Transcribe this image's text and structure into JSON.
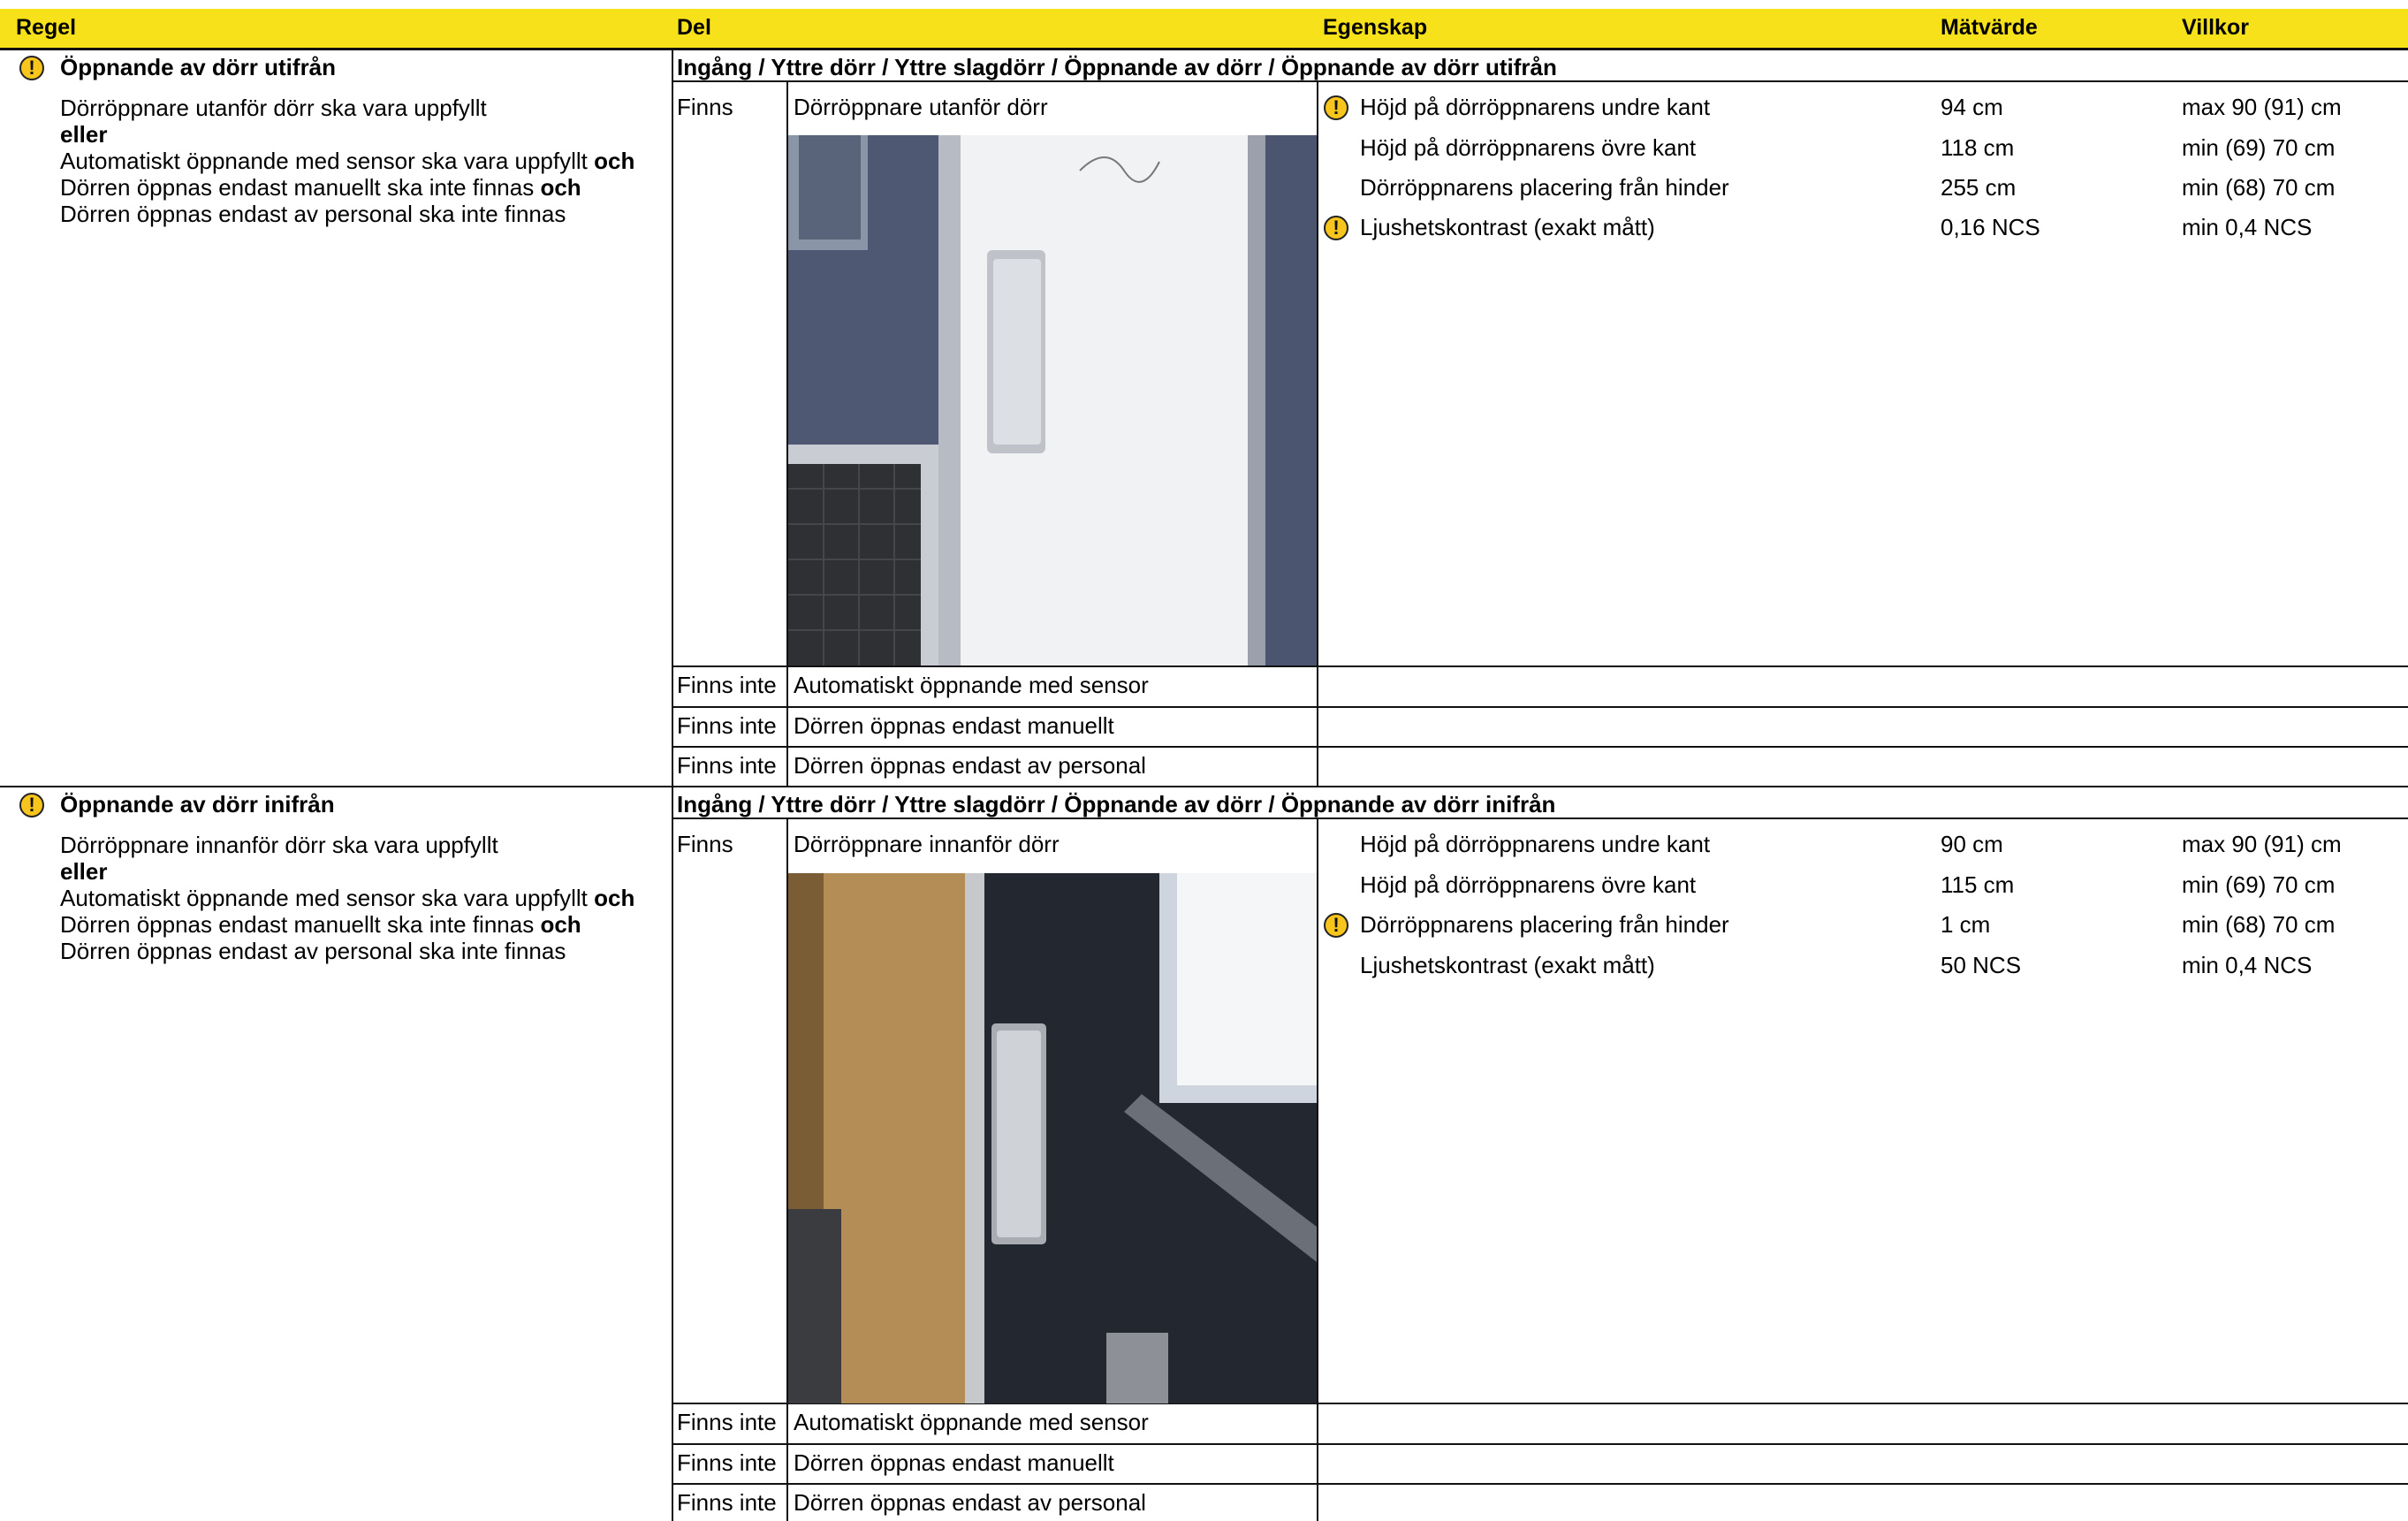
{
  "header": {
    "regel": "Regel",
    "del": "Del",
    "egenskap": "Egenskap",
    "matvarde": "Mätvärde",
    "villkor": "Villkor"
  },
  "sections": [
    {
      "title": "Öppnande av dörr utifrån",
      "rule_lines": [
        "Dörröppnare utanför dörr ska vara uppfyllt",
        "eller",
        "Automatiskt öppnande med sensor ska vara uppfyllt",
        "Dörren öppnas endast manuellt ska inte finnas",
        "Dörren öppnas endast av personal ska inte finnas"
      ],
      "och": "och",
      "path": "Ingång / Yttre dörr / Yttre slagdörr  / Öppnande av dörr / Öppnande av dörr utifrån",
      "parts": [
        {
          "status": "Finns",
          "name": "Dörröppnare utanför dörr"
        },
        {
          "status": "Finns inte",
          "name": "Automatiskt öppnande med sensor"
        },
        {
          "status": "Finns inte",
          "name": "Dörren öppnas endast manuellt"
        },
        {
          "status": "Finns inte",
          "name": "Dörren öppnas endast av personal"
        }
      ],
      "measurements": [
        {
          "property": "Höjd på dörröppnarens undre kant",
          "value": "94 cm",
          "condition": "max 90 (91) cm",
          "warning": true
        },
        {
          "property": "Höjd på dörröppnarens övre kant",
          "value": "118 cm",
          "condition": "min (69) 70 cm",
          "warning": false
        },
        {
          "property": "Dörröppnarens placering från hinder",
          "value": "255 cm",
          "condition": "min (68) 70 cm",
          "warning": false
        },
        {
          "property": "Ljushetskontrast (exakt mått)",
          "value": "0,16 NCS",
          "condition": "min 0,4 NCS",
          "warning": true
        }
      ]
    },
    {
      "title": "Öppnande av dörr inifrån",
      "rule_lines": [
        "Dörröppnare innanför dörr ska vara uppfyllt",
        "eller",
        "Automatiskt öppnande med sensor ska vara uppfyllt",
        "Dörren öppnas endast manuellt ska inte finnas",
        "Dörren öppnas endast av personal ska inte finnas"
      ],
      "och": "och",
      "path": "Ingång / Yttre dörr / Yttre slagdörr  / Öppnande av dörr / Öppnande av dörr inifrån",
      "parts": [
        {
          "status": "Finns",
          "name": "Dörröppnare innanför dörr"
        },
        {
          "status": "Finns inte",
          "name": "Automatiskt öppnande med sensor"
        },
        {
          "status": "Finns inte",
          "name": "Dörren öppnas endast manuellt"
        },
        {
          "status": "Finns inte",
          "name": "Dörren öppnas endast av personal"
        }
      ],
      "measurements": [
        {
          "property": "Höjd på dörröppnarens undre kant",
          "value": "90 cm",
          "condition": "max 90 (91) cm",
          "warning": false
        },
        {
          "property": "Höjd på dörröppnarens övre kant",
          "value": "115 cm",
          "condition": "min (69) 70 cm",
          "warning": false
        },
        {
          "property": "Dörröppnarens placering från hinder",
          "value": "1 cm",
          "condition": "min (68) 70 cm",
          "warning": true
        },
        {
          "property": "Ljushetskontrast (exakt mått)",
          "value": "50 NCS",
          "condition": "min 0,4 NCS",
          "warning": false
        }
      ]
    }
  ],
  "icons": {
    "warning": "warning-icon",
    "warning_glyph": "!"
  },
  "colors": {
    "header_bg": "#f7e11a",
    "warning": "#f7c51b"
  }
}
